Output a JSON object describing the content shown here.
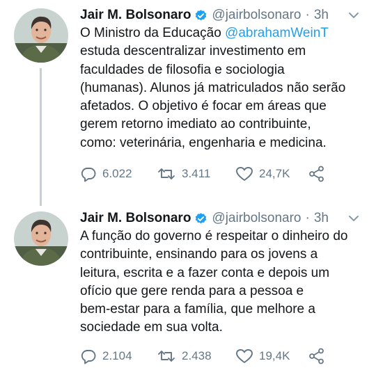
{
  "tweets": [
    {
      "author": "Jair M. Bolsonaro",
      "handle": "@jairbolsonaro",
      "dot": "·",
      "time": "3h",
      "text_before": "O Ministro da Educação ",
      "mention": "@abrahamWeinT",
      "text_after": "\nestuda descentralizar investimento em\nfaculdades de filosofia e sociologia\n(humanas). Alunos já matriculados não serão\nafetados. O objetivo é focar em áreas que\ngerem retorno imediato ao contribuinte,\ncomo: veterinária, engenharia e medicina.",
      "replies": "6.022",
      "retweets": "3.411",
      "likes": "24,7K",
      "icons": [
        "verified-badge-icon",
        "chevron-down-icon",
        "reply-icon",
        "retweet-icon",
        "heart-icon",
        "share-icon"
      ]
    },
    {
      "author": "Jair M. Bolsonaro",
      "handle": "@jairbolsonaro",
      "dot": "·",
      "time": "3h",
      "text": "A função do governo é respeitar o dinheiro do\ncontribuinte, ensinando para os jovens a\nleitura, escrita e a fazer conta e depois um\nofício que gere renda para a pessoa e\nbem-estar para a família, que melhore a\nsociedade em sua volta.",
      "replies": "2.104",
      "retweets": "2.438",
      "likes": "19,4K",
      "icons": [
        "verified-badge-icon",
        "chevron-down-icon",
        "reply-icon",
        "retweet-icon",
        "heart-icon",
        "share-icon"
      ]
    }
  ],
  "colors": {
    "text": "#14171a",
    "secondary": "#657786",
    "link": "#1da1f2",
    "verified": "#1da1f2",
    "thread_line": "#c4cfd6"
  }
}
